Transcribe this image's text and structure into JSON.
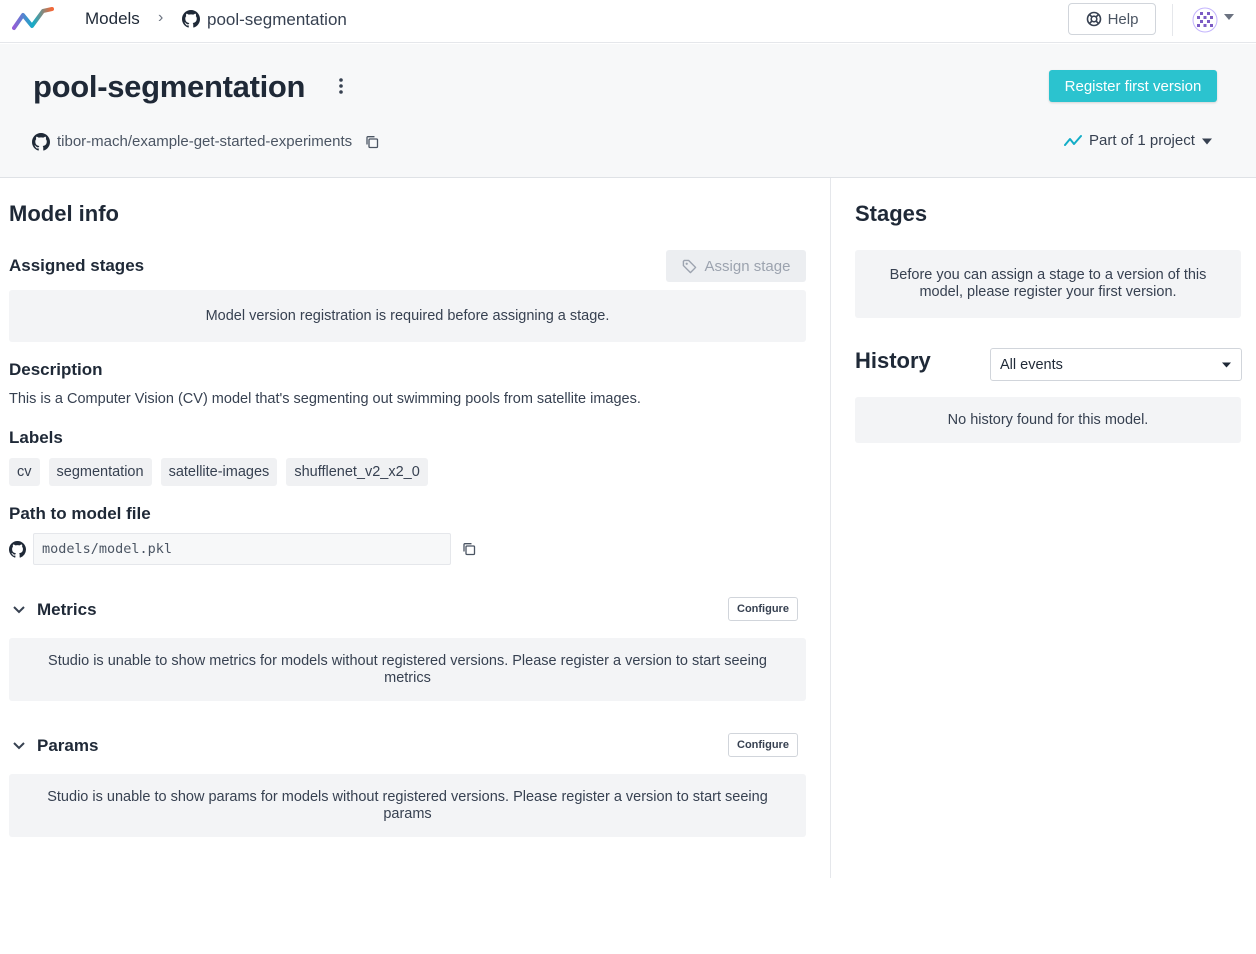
{
  "topbar": {
    "breadcrumb_models": "Models",
    "breadcrumb_separator": "›",
    "breadcrumb_repo": "pool-segmentation",
    "help_label": "Help",
    "icons": [
      "logo-icon",
      "github-icon",
      "help-lifebuoy-icon",
      "avatar-icon",
      "caret-down-icon"
    ]
  },
  "header": {
    "title": "pool-segmentation",
    "register_button": "Register first version",
    "repo_path": "tibor-mach/example-get-started-experiments",
    "project_label": "Part of 1 project",
    "accent_color": "#2bc3cf"
  },
  "model_info": {
    "title": "Model info",
    "assigned_stages": {
      "title": "Assigned stages",
      "assign_button": "Assign stage",
      "notice": "Model version registration is required before assigning a stage."
    },
    "description": {
      "title": "Description",
      "text": "This is a Computer Vision (CV) model that's segmenting out swimming pools from satellite images."
    },
    "labels": {
      "title": "Labels",
      "items": [
        "cv",
        "segmentation",
        "satellite-images",
        "shufflenet_v2_x2_0"
      ]
    },
    "path": {
      "title": "Path to model file",
      "value": "models/model.pkl"
    },
    "metrics": {
      "title": "Metrics",
      "configure": "Configure",
      "notice_line1": "Studio is unable to show metrics for models without registered versions. Please register a version to start seeing",
      "notice_line2": "metrics"
    },
    "params": {
      "title": "Params",
      "configure": "Configure",
      "notice_line1": "Studio is unable to show params for models without registered versions. Please register a version to start seeing",
      "notice_line2": "params"
    }
  },
  "stages": {
    "title": "Stages",
    "notice_line1": "Before you can assign a stage to a version of this",
    "notice_line2": "model, please register your first version."
  },
  "history": {
    "title": "History",
    "filter_selected": "All events",
    "empty_text": "No history found for this model."
  }
}
